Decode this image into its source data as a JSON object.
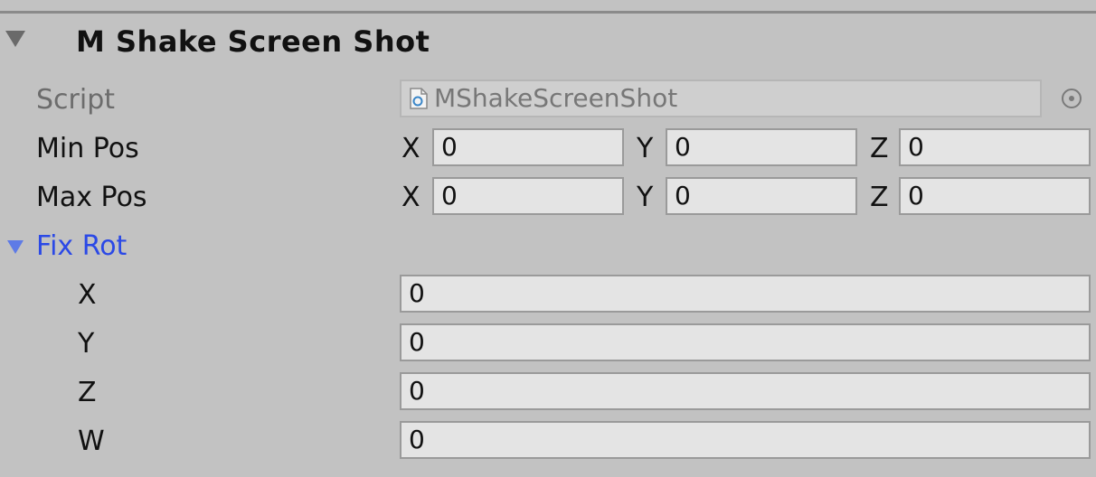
{
  "component": {
    "title": "M Shake Screen Shot"
  },
  "script_field": {
    "label": "Script",
    "value": "MShakeScreenShot",
    "icon": "script-file-icon",
    "picker_icon": "object-picker-icon"
  },
  "min_pos": {
    "label": "Min Pos",
    "x_label": "X",
    "x": "0",
    "y_label": "Y",
    "y": "0",
    "z_label": "Z",
    "z": "0"
  },
  "max_pos": {
    "label": "Max Pos",
    "x_label": "X",
    "x": "0",
    "y_label": "Y",
    "y": "0",
    "z_label": "Z",
    "z": "0"
  },
  "fix_rot": {
    "label": "Fix Rot",
    "fields": [
      {
        "label": "X",
        "value": "0"
      },
      {
        "label": "Y",
        "value": "0"
      },
      {
        "label": "Z",
        "value": "0"
      },
      {
        "label": "W",
        "value": "0"
      }
    ]
  },
  "colors": {
    "background": "#c2c2c2",
    "foldout_label": "#2b49e6",
    "field_bg": "#e4e4e4"
  }
}
